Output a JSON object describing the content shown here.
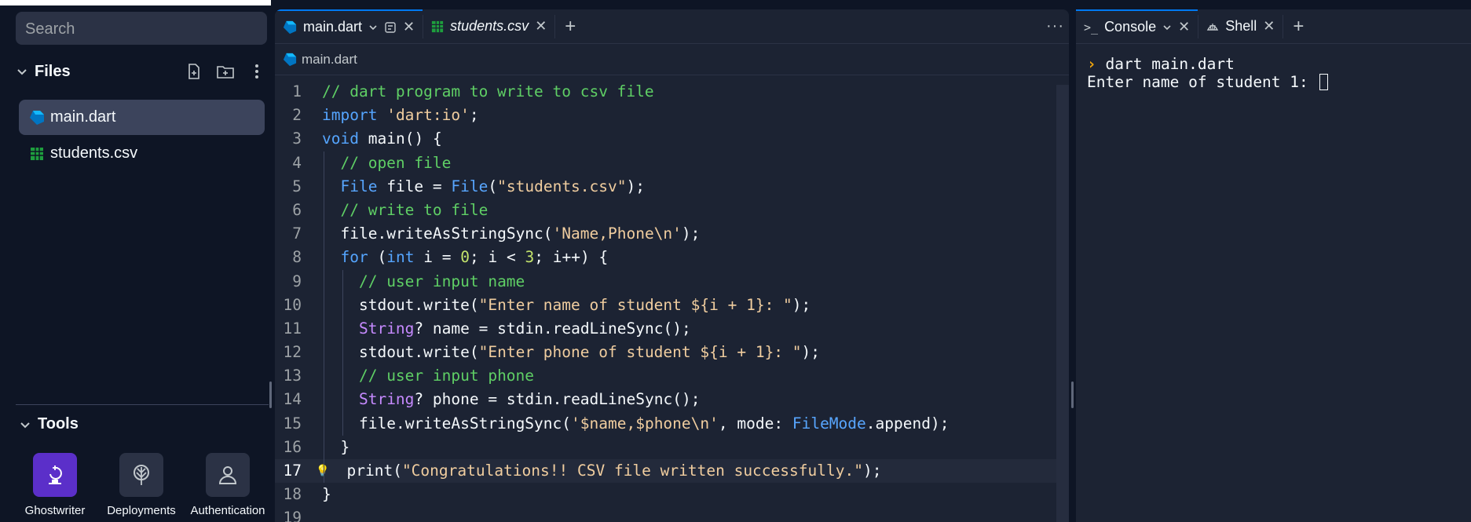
{
  "sidebar": {
    "search_placeholder": "Search",
    "files_title": "Files",
    "files": [
      {
        "name": "main.dart",
        "icon": "dart-icon",
        "active": true
      },
      {
        "name": "students.csv",
        "icon": "csv-icon",
        "active": false
      }
    ],
    "tools_title": "Tools",
    "tools": [
      {
        "label": "Ghostwriter",
        "icon": "ghostwriter-icon"
      },
      {
        "label": "Deployments",
        "icon": "deployments-icon"
      },
      {
        "label": "Authentication",
        "icon": "authentication-icon"
      }
    ]
  },
  "editor": {
    "tabs": [
      {
        "label": "main.dart",
        "icon": "dart-icon",
        "active": true
      },
      {
        "label": "students.csv",
        "icon": "csv-icon",
        "active": false
      }
    ],
    "breadcrumb": "main.dart",
    "current_line": 17,
    "lines": [
      "// dart program to write to csv file",
      "import 'dart:io';",
      "void main() {",
      "  // open file",
      "  File file = File(\"students.csv\");",
      "  // write to file",
      "  file.writeAsStringSync('Name,Phone\\n');",
      "  for (int i = 0; i < 3; i++) {",
      "    // user input name",
      "    stdout.write(\"Enter name of student ${i + 1}: \");",
      "    String? name = stdin.readLineSync();",
      "    stdout.write(\"Enter phone of student ${i + 1}: \");",
      "    // user input phone",
      "    String? phone = stdin.readLineSync();",
      "    file.writeAsStringSync('$name,$phone\\n', mode: FileMode.append);",
      "  }",
      "  print(\"Congratulations!! CSV file written successfully.\");",
      "}",
      ""
    ]
  },
  "console": {
    "tabs": [
      {
        "label": "Console",
        "icon": "console-icon",
        "active": true
      },
      {
        "label": "Shell",
        "icon": "shell-icon",
        "active": false
      }
    ],
    "command": "dart main.dart",
    "output": "Enter name of student 1: "
  },
  "colors": {
    "background": "#0e1525",
    "panel": "#1c2333",
    "accent": "#0079f2",
    "ghostwriter": "#5b2fc9"
  }
}
